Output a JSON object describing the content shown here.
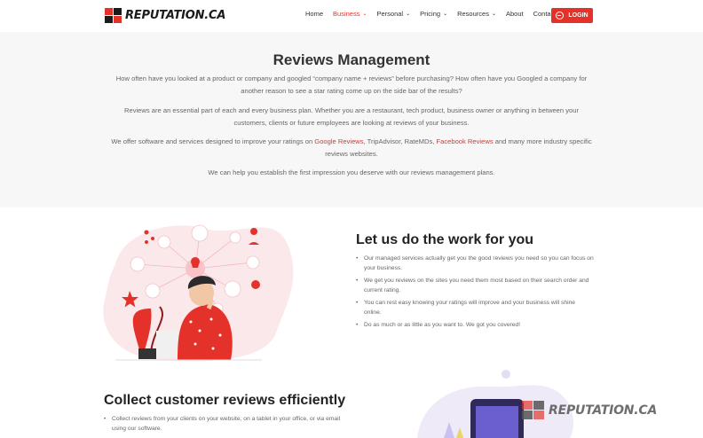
{
  "header": {
    "logo_text": "REPUTATION.CA",
    "nav": [
      {
        "label": "Home",
        "caret": false,
        "active": false
      },
      {
        "label": "Business",
        "caret": true,
        "active": true
      },
      {
        "label": "Personal",
        "caret": true,
        "active": false
      },
      {
        "label": "Pricing",
        "caret": true,
        "active": false
      },
      {
        "label": "Resources",
        "caret": true,
        "active": false
      },
      {
        "label": "About",
        "caret": false,
        "active": false
      },
      {
        "label": "Contact",
        "caret": false,
        "active": false
      }
    ],
    "login_label": "LOGIN"
  },
  "intro": {
    "title": "Reviews Management",
    "p1": "How often have you looked at a product or company and googled “company name + reviews” before purchasing? How often have you Googled a company for another reason to see a star rating come up on the side bar of the results?",
    "p2": "Reviews are an essential part of each and every business plan. Whether you are a restaurant, tech product, business owner or anything in between your customers, clients or future employees are looking at reviews of your business.",
    "p3_a": "We offer software and services designed to improve your ratings on ",
    "p3_link1": "Google Reviews",
    "p3_b": ", TripAdvisor, RateMDs, ",
    "p3_link2": "Facebook Reviews",
    "p3_c": " and many more industry specific reviews websites.",
    "p4": "We can help you establish the first impression you deserve with our reviews management plans."
  },
  "work": {
    "title": "Let us do the work for you",
    "items": [
      "Our managed services actually get you the good reviews you need so you can focus on your business.",
      "We get you reviews on the sites you need them most based on their search order and current rating.",
      "You can rest easy knowing your ratings will improve and your business will shine online.",
      "Do as much or as little as you want to. We got you covered!"
    ]
  },
  "collect": {
    "title": "Collect customer reviews efficiently",
    "items": [
      "Collect reviews from your clients on your website, on a tablet in your office, or via email using our software."
    ]
  },
  "watermark_text": "REPUTATION.CA",
  "colors": {
    "accent": "#e4322b",
    "dark": "#1b1b1b",
    "intro_bg": "#f7f7f7"
  }
}
